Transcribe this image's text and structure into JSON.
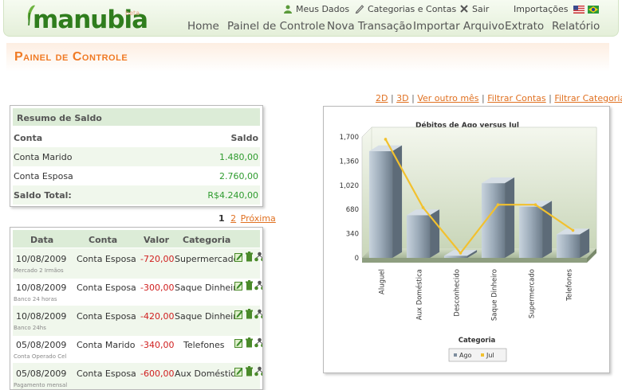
{
  "header": {
    "logo_text": "manubia",
    "logo_beta": "beta",
    "top_links": [
      {
        "label": "Meus Dados",
        "icon": "user-icon"
      },
      {
        "label": "Categorias e Contas",
        "icon": "pencil-icon"
      },
      {
        "label": "Sair",
        "icon": "close-icon"
      },
      {
        "label": "Importações",
        "icon": ""
      }
    ],
    "flags": [
      "us-flag-icon",
      "brazil-flag-icon"
    ],
    "nav": [
      "Home",
      "Painel de Controle",
      "Nova Transação",
      "Importar Arquivo",
      "Extrato",
      "Relatório"
    ]
  },
  "page": {
    "title": "Painel de Controle"
  },
  "saldo": {
    "title": "Resumo de Saldo",
    "col_conta": "Conta",
    "col_saldo": "Saldo",
    "rows": [
      {
        "conta": "Conta Marido",
        "saldo": "1.480,00"
      },
      {
        "conta": "Conta Esposa",
        "saldo": "2.760,00"
      }
    ],
    "total_label": "Saldo Total:",
    "total_value": "R$4.240,00"
  },
  "pager": {
    "current": "1",
    "next_page": "2",
    "next_label": "Próxima"
  },
  "transactions": {
    "headers": [
      "Data",
      "Conta",
      "Valor",
      "Categoria"
    ],
    "rows": [
      {
        "data": "10/08/2009",
        "conta": "Conta Esposa",
        "valor": "-720,00",
        "categoria": "Supermercado",
        "note": "Mercado 2 Irmãos"
      },
      {
        "data": "10/08/2009",
        "conta": "Conta Esposa",
        "valor": "-300,00",
        "categoria": "Saque Dinheiro",
        "note": "Banco 24 horas"
      },
      {
        "data": "10/08/2009",
        "conta": "Conta Esposa",
        "valor": "-420,00",
        "categoria": "Saque Dinheiro",
        "note": "Banco 24hs"
      },
      {
        "data": "05/08/2009",
        "conta": "Conta Marido",
        "valor": "-340,00",
        "categoria": "Telefones",
        "note": "Conta Operado Cel"
      },
      {
        "data": "05/08/2009",
        "conta": "Conta Esposa",
        "valor": "-600,00",
        "categoria": "Aux Doméstica",
        "note": "Pagamento mensal"
      }
    ]
  },
  "chart_links": [
    "2D",
    "3D",
    "Ver outro mês",
    "Filtrar Contas",
    "Filtrar Categorias"
  ],
  "colors": {
    "accent": "#f07a24",
    "green": "#2e9b2e",
    "red": "#d02020",
    "bar": "#8a9aa9",
    "line": "#f2c12e"
  },
  "chart_data": {
    "type": "bar",
    "title": "Débitos de Ago versus Jul",
    "xlabel": "Categoria",
    "ylabel": "",
    "categories": [
      "Aluguel",
      "Aux Doméstica",
      "Desconhecido",
      "Saque Dinheiro",
      "Supermercado",
      "Telefones"
    ],
    "series": [
      {
        "name": "Ago",
        "type": "bar",
        "values": [
          1500,
          600,
          30,
          1050,
          720,
          330
        ]
      },
      {
        "name": "Jul",
        "type": "line",
        "values": [
          1600,
          640,
          0,
          680,
          680,
          320
        ]
      }
    ],
    "yticks": [
      "1,700",
      "1,360",
      "1,020",
      "680",
      "340",
      "0"
    ],
    "ylim": [
      0,
      1700
    ],
    "legend_position": "bottom",
    "grid": false
  }
}
